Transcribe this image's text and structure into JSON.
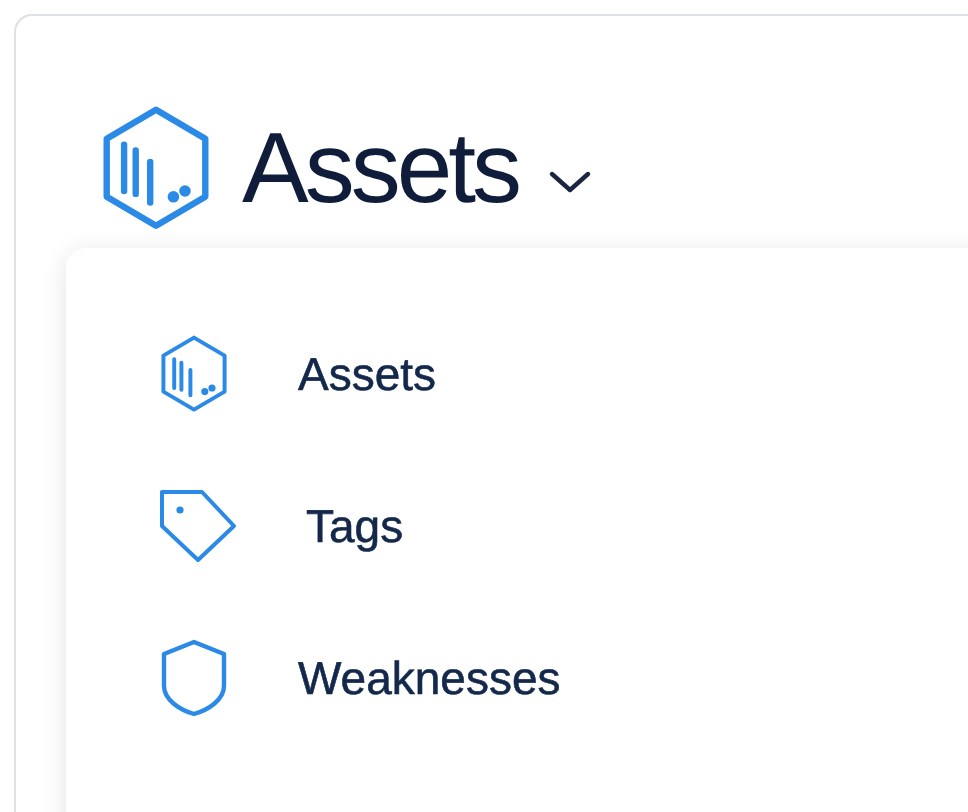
{
  "header": {
    "title": "Assets"
  },
  "menu": {
    "items": [
      {
        "label": "Assets"
      },
      {
        "label": "Tags"
      },
      {
        "label": "Weaknesses"
      }
    ]
  }
}
